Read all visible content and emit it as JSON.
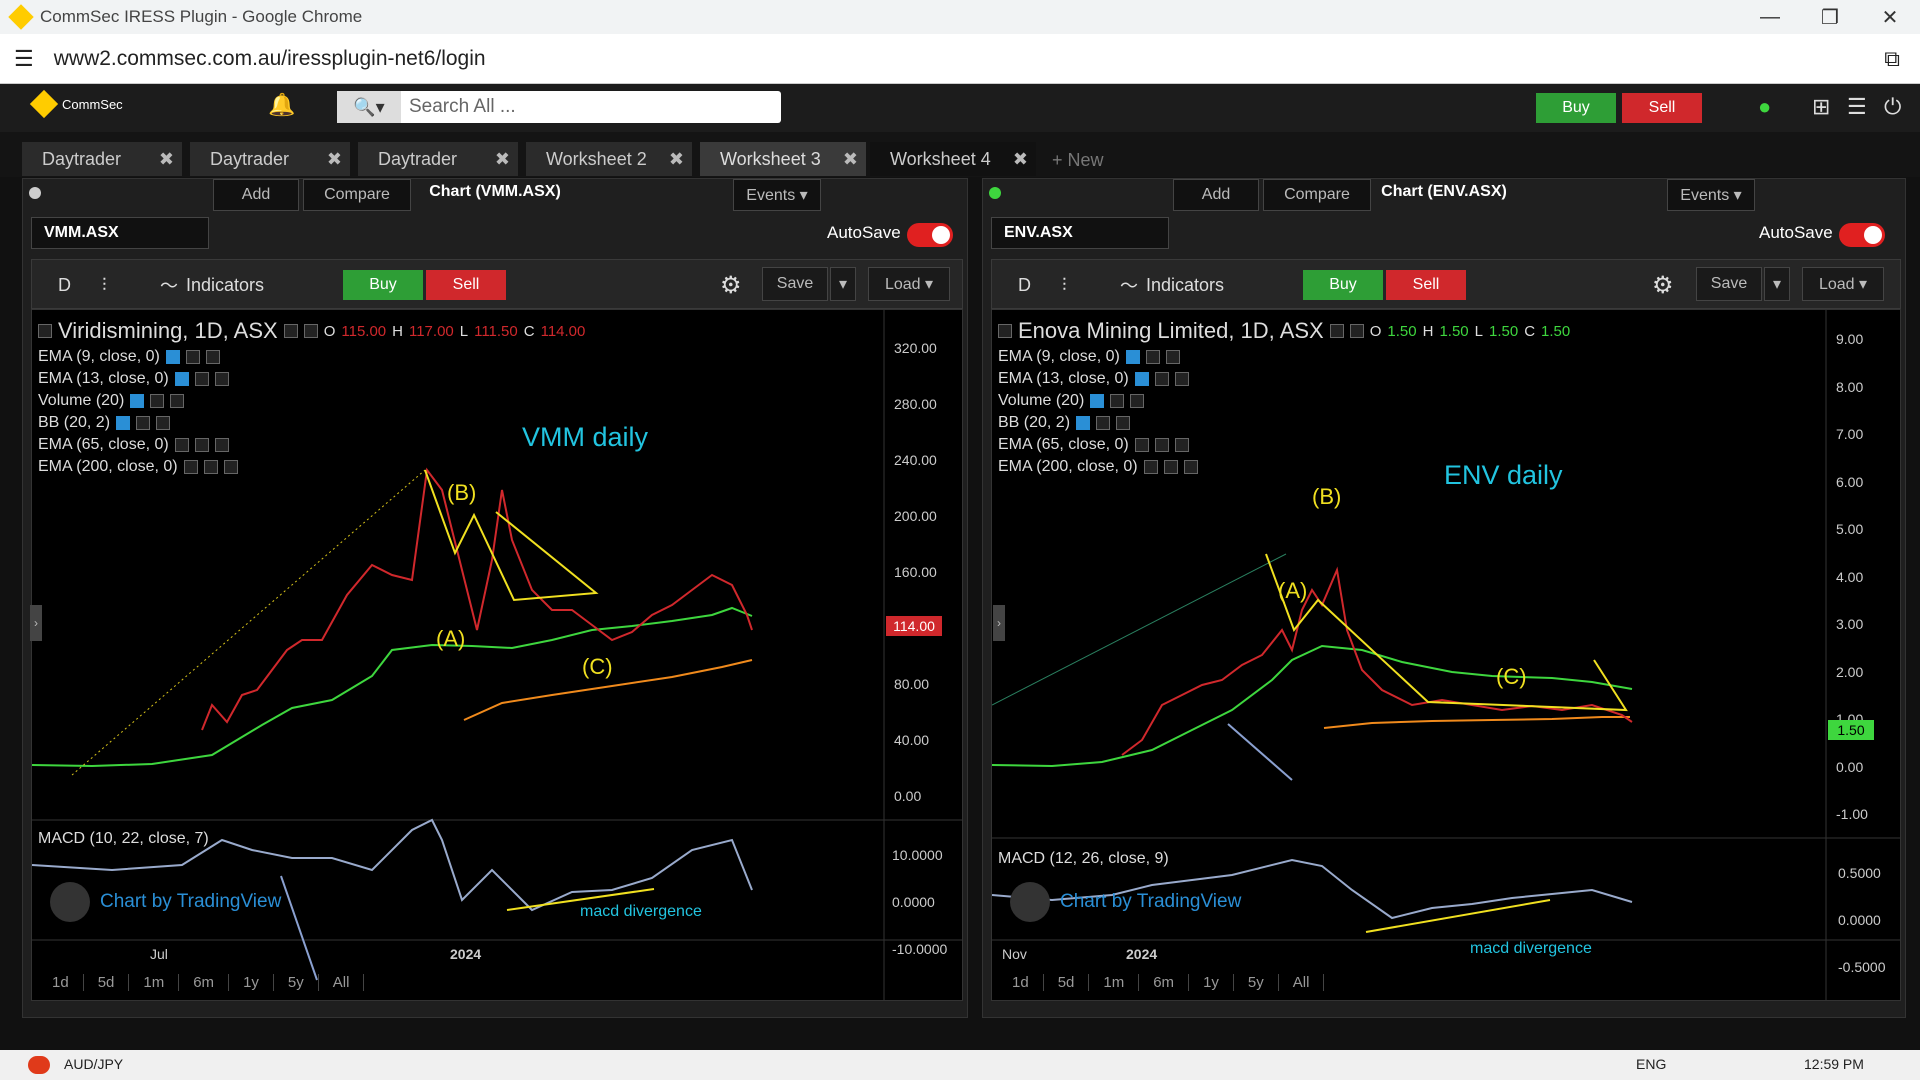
{
  "browser": {
    "title": "CommSec IRESS Plugin - Google Chrome",
    "url": "www2.commsec.com.au/iressplugin-net6/login"
  },
  "appbar": {
    "brand": "CommSec",
    "search_placeholder": "Search All ...",
    "buy_label": "Buy",
    "sell_label": "Sell"
  },
  "tabs": [
    {
      "label": "Daytrader"
    },
    {
      "label": "Daytrader"
    },
    {
      "label": "Daytrader"
    },
    {
      "label": "Worksheet 2"
    },
    {
      "label": "Worksheet 3"
    },
    {
      "label": "Worksheet 4"
    }
  ],
  "new_tab_label": "+ New",
  "left": {
    "header": "Chart (VMM.ASX)",
    "symbol": "VMM.ASX",
    "add": "Add",
    "compare": "Compare",
    "events": "Events ▾",
    "autosave": "AutoSave",
    "interval": "D",
    "indicators": "Indicators",
    "buy": "Buy",
    "sell": "Sell",
    "save": "Save",
    "load": "Load ▾",
    "title": "Viridismining, 1D, ASX",
    "o_label": "O",
    "o": "115.00",
    "h_label": "H",
    "h": "117.00",
    "l_label": "L",
    "l": "111.50",
    "c_label": "C",
    "c": "114.00",
    "studies": [
      "EMA (9, close, 0)",
      "EMA (13, close, 0)",
      "Volume (20)",
      "BB (20, 2)",
      "EMA (65, close, 0)",
      "EMA (200, close, 0)"
    ],
    "macd": "MACD (10, 22, close, 7)",
    "annotation": "VMM daily",
    "wave_labels": [
      "(A)",
      "(B)",
      "(C)"
    ],
    "divergence": "macd divergence",
    "price_ticks": [
      "320.00",
      "280.00",
      "240.00",
      "200.00",
      "160.00",
      "80.00",
      "40.00",
      "0.00"
    ],
    "last_price": "114.00",
    "macd_ticks": [
      "10.0000",
      "0.0000",
      "-10.0000"
    ],
    "time_ticks": [
      "Jul",
      "2024"
    ],
    "tradingview": "Chart by TradingView",
    "timeframes": [
      "1d",
      "5d",
      "1m",
      "6m",
      "1y",
      "5y",
      "All"
    ]
  },
  "right": {
    "header": "Chart (ENV.ASX)",
    "symbol": "ENV.ASX",
    "add": "Add",
    "compare": "Compare",
    "events": "Events ▾",
    "autosave": "AutoSave",
    "interval": "D",
    "indicators": "Indicators",
    "buy": "Buy",
    "sell": "Sell",
    "save": "Save",
    "load": "Load ▾",
    "title": "Enova Mining Limited, 1D, ASX",
    "o_label": "O",
    "o": "1.50",
    "h_label": "H",
    "h": "1.50",
    "l_label": "L",
    "l": "1.50",
    "c_label": "C",
    "c": "1.50",
    "studies": [
      "EMA (9, close, 0)",
      "EMA (13, close, 0)",
      "Volume (20)",
      "BB (20, 2)",
      "EMA (65, close, 0)",
      "EMA (200, close, 0)"
    ],
    "macd": "MACD (12, 26, close, 9)",
    "annotation": "ENV daily",
    "wave_labels": [
      "(A)",
      "(B)",
      "(C)"
    ],
    "divergence": "macd divergence",
    "price_ticks": [
      "9.00",
      "8.00",
      "7.00",
      "6.00",
      "5.00",
      "4.00",
      "3.00",
      "2.00",
      "1.00",
      "0.00",
      "-1.00"
    ],
    "last_price": "1.50",
    "macd_ticks": [
      "0.5000",
      "0.0000",
      "-0.5000"
    ],
    "time_ticks": [
      "Nov",
      "2024"
    ],
    "tradingview": "Chart by TradingView",
    "timeframes": [
      "1d",
      "5d",
      "1m",
      "6m",
      "1y",
      "5y",
      "All"
    ]
  },
  "taskbar": {
    "ticker": "AUD/JPY",
    "lang": "ENG",
    "time": "12:59 PM"
  },
  "colors": {
    "buy": "#2e9e36",
    "sell": "#d0282c",
    "annotation": "#22c4e0",
    "wave": "#f0e020",
    "ema_green": "#3ed63e",
    "ema_orange": "#f08a1c"
  }
}
